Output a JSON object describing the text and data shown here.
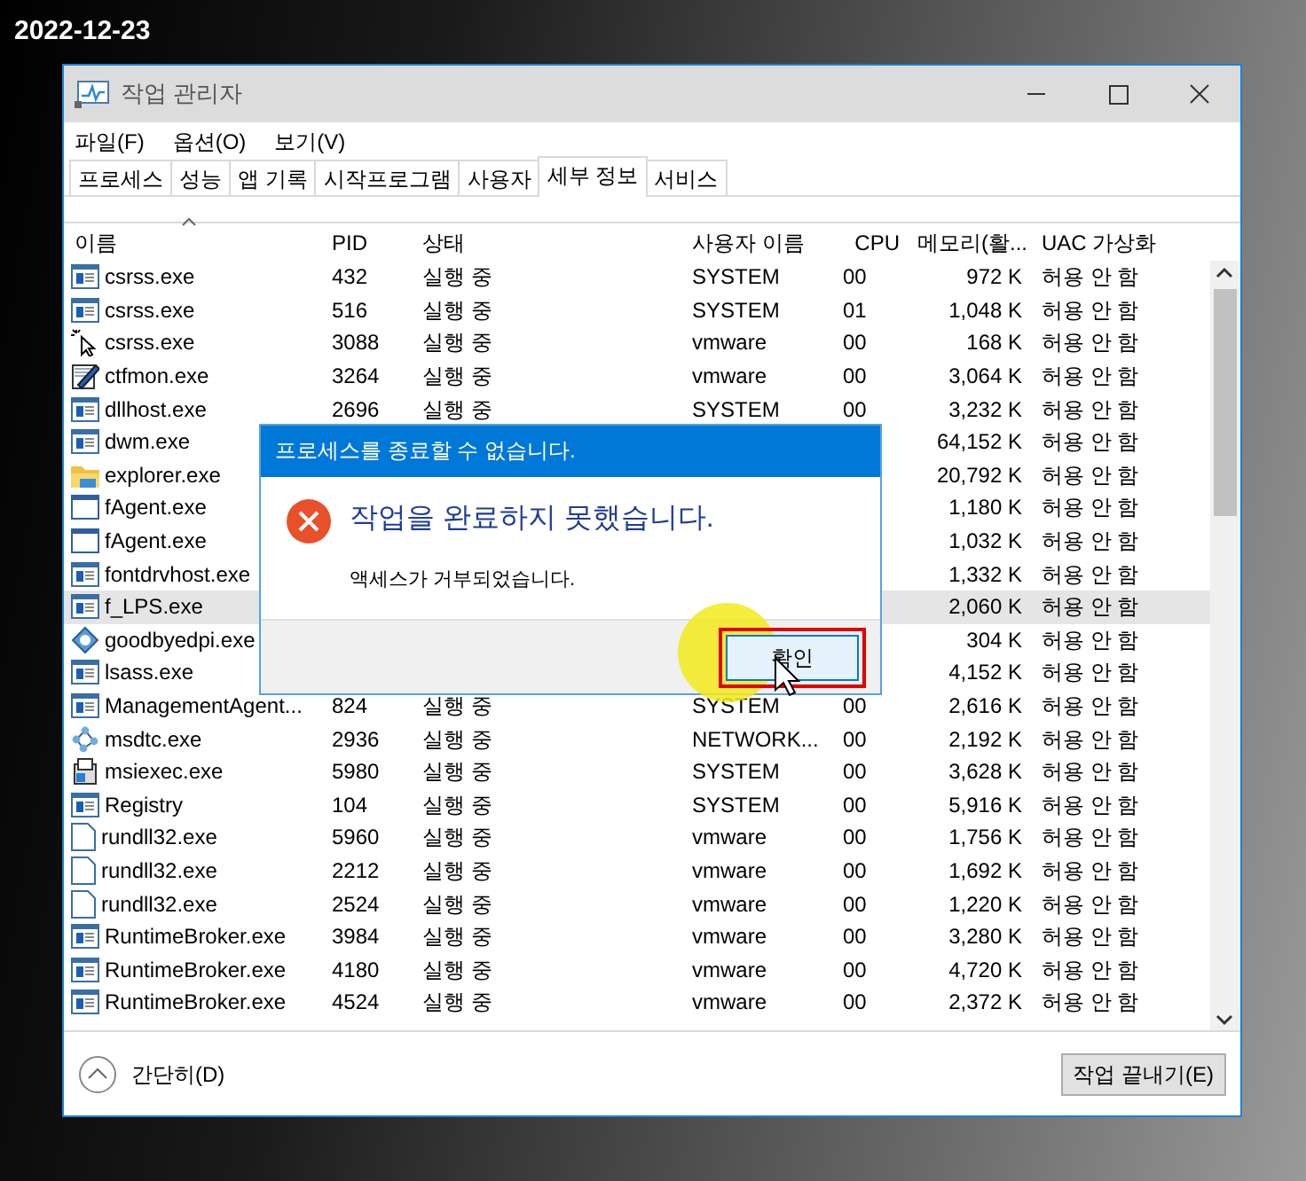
{
  "caption": "2022-12-23",
  "window": {
    "title": "작업 관리자"
  },
  "menu": [
    "파일(F)",
    "옵션(O)",
    "보기(V)"
  ],
  "tabs": [
    {
      "label": "프로세스",
      "selected": false
    },
    {
      "label": "성능",
      "selected": false
    },
    {
      "label": "앱 기록",
      "selected": false
    },
    {
      "label": "시작프로그램",
      "selected": false
    },
    {
      "label": "사용자",
      "selected": false
    },
    {
      "label": "세부 정보",
      "selected": true
    },
    {
      "label": "서비스",
      "selected": false
    }
  ],
  "table": {
    "columns": [
      "이름",
      "PID",
      "상태",
      "사용자 이름",
      "CPU",
      "메모리(활...",
      "UAC 가상화"
    ],
    "rows": [
      {
        "kind": "window",
        "name": "csrss.exe",
        "pid": "432",
        "status": "실행 중",
        "user": "SYSTEM",
        "cpu": "00",
        "memory": "972 K",
        "uac": "허용 안 함",
        "selected": false
      },
      {
        "kind": "window",
        "name": "csrss.exe",
        "pid": "516",
        "status": "실행 중",
        "user": "SYSTEM",
        "cpu": "01",
        "memory": "1,048 K",
        "uac": "허용 안 함",
        "selected": false
      },
      {
        "kind": "cursor",
        "name": "csrss.exe",
        "pid": "3088",
        "status": "실행 중",
        "user": "vmware",
        "cpu": "00",
        "memory": "168 K",
        "uac": "허용 안 함",
        "selected": false
      },
      {
        "kind": "pen",
        "name": "ctfmon.exe",
        "pid": "3264",
        "status": "실행 중",
        "user": "vmware",
        "cpu": "00",
        "memory": "3,064 K",
        "uac": "허용 안 함",
        "selected": false
      },
      {
        "kind": "window",
        "name": "dllhost.exe",
        "pid": "2696",
        "status": "실행 중",
        "user": "SYSTEM",
        "cpu": "00",
        "memory": "3,232 K",
        "uac": "허용 안 함",
        "selected": false
      },
      {
        "kind": "window",
        "name": "dwm.exe",
        "memory": "64,152 K",
        "uac": "허용 안 함",
        "selected": false
      },
      {
        "kind": "folder",
        "name": "explorer.exe",
        "memory": "20,792 K",
        "uac": "허용 안 함",
        "selected": false
      },
      {
        "kind": "frame",
        "name": "fAgent.exe",
        "memory": "1,180 K",
        "uac": "허용 안 함",
        "selected": false
      },
      {
        "kind": "frame",
        "name": "fAgent.exe",
        "memory": "1,032 K",
        "uac": "허용 안 함",
        "selected": false
      },
      {
        "kind": "window",
        "name": "fontdrvhost.exe",
        "memory": "1,332 K",
        "uac": "허용 안 함",
        "selected": false
      },
      {
        "kind": "window",
        "name": "f_LPS.exe",
        "memory": "2,060 K",
        "uac": "허용 안 함",
        "selected": true
      },
      {
        "kind": "gear",
        "name": "goodbyedpi.exe",
        "memory": "304 K",
        "uac": "허용 안 함",
        "selected": false
      },
      {
        "kind": "window",
        "name": "lsass.exe",
        "memory": "4,152 K",
        "uac": "허용 안 함",
        "selected": false
      },
      {
        "kind": "window",
        "name": "ManagementAgent...",
        "pid": "824",
        "status": "실행 중",
        "user": "SYSTEM",
        "cpu": "00",
        "memory": "2,616 K",
        "uac": "허용 안 함",
        "selected": false
      },
      {
        "kind": "network",
        "name": "msdtc.exe",
        "pid": "2936",
        "status": "실행 중",
        "user": "NETWORK...",
        "cpu": "00",
        "memory": "2,192 K",
        "uac": "허용 안 함",
        "selected": false
      },
      {
        "kind": "installer",
        "name": "msiexec.exe",
        "pid": "5980",
        "status": "실행 중",
        "user": "SYSTEM",
        "cpu": "00",
        "memory": "3,628 K",
        "uac": "허용 안 함",
        "selected": false
      },
      {
        "kind": "window",
        "name": "Registry",
        "pid": "104",
        "status": "실행 중",
        "user": "SYSTEM",
        "cpu": "00",
        "memory": "5,916 K",
        "uac": "허용 안 함",
        "selected": false
      },
      {
        "kind": "page",
        "name": "rundll32.exe",
        "pid": "5960",
        "status": "실행 중",
        "user": "vmware",
        "cpu": "00",
        "memory": "1,756 K",
        "uac": "허용 안 함",
        "selected": false
      },
      {
        "kind": "page",
        "name": "rundll32.exe",
        "pid": "2212",
        "status": "실행 중",
        "user": "vmware",
        "cpu": "00",
        "memory": "1,692 K",
        "uac": "허용 안 함",
        "selected": false
      },
      {
        "kind": "page",
        "name": "rundll32.exe",
        "pid": "2524",
        "status": "실행 중",
        "user": "vmware",
        "cpu": "00",
        "memory": "1,220 K",
        "uac": "허용 안 함",
        "selected": false
      },
      {
        "kind": "window",
        "name": "RuntimeBroker.exe",
        "pid": "3984",
        "status": "실행 중",
        "user": "vmware",
        "cpu": "00",
        "memory": "3,280 K",
        "uac": "허용 안 함",
        "selected": false
      },
      {
        "kind": "window",
        "name": "RuntimeBroker.exe",
        "pid": "4180",
        "status": "실행 중",
        "user": "vmware",
        "cpu": "00",
        "memory": "4,720 K",
        "uac": "허용 안 함",
        "selected": false
      },
      {
        "kind": "window",
        "name": "RuntimeBroker.exe",
        "pid": "4524",
        "status": "실행 중",
        "user": "vmware",
        "cpu": "00",
        "memory": "2,372 K",
        "uac": "허용 안 함",
        "selected": false
      }
    ]
  },
  "footer": {
    "toggle": "간단히(D)",
    "button": "작업 끝내기(E)"
  },
  "dialog": {
    "title": "프로세스를 종료할 수 없습니다.",
    "heading": "작업을 완료하지 못했습니다.",
    "message": "액세스가 거부되었습니다.",
    "button": "확인",
    "button_marked": true
  }
}
